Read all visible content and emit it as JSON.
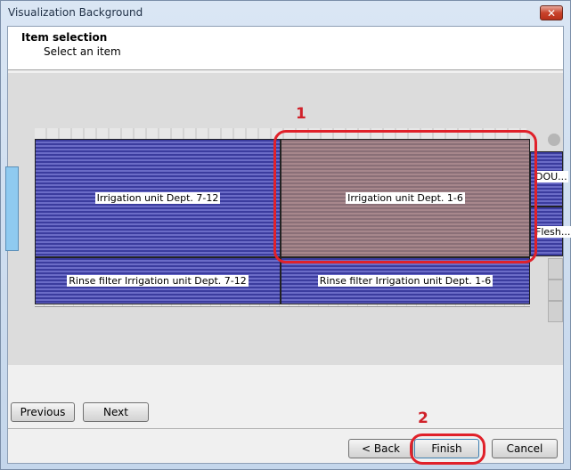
{
  "window": {
    "title": "Visualization Background",
    "close_symbol": "✕"
  },
  "header": {
    "title": "Item selection",
    "subtitle": "Select an item"
  },
  "visualization": {
    "cells": [
      {
        "label": "Irrigation unit Dept. 7-12",
        "color": "#5556b4"
      },
      {
        "label": "Irrigation unit Dept. 1-6",
        "color": "#9a7c82"
      },
      {
        "label": "Rinse filter Irrigation unit Dept. 7-12",
        "color": "#5556b4"
      },
      {
        "label": "Rinse filter Irrigation unit Dept. 1-6",
        "color": "#5556b4"
      }
    ],
    "side_items": [
      {
        "label": "DOU..."
      },
      {
        "label": "Flesh..."
      }
    ]
  },
  "annotations": [
    {
      "number": "1",
      "target": "Irrigation unit Dept. 1-6"
    },
    {
      "number": "2",
      "target": "Finish"
    }
  ],
  "buttons": {
    "previous": "Previous",
    "next": "Next",
    "back": "< Back",
    "finish": "Finish",
    "cancel": "Cancel"
  },
  "colors": {
    "annotation": "#e0212a",
    "cell_blue": "#5556b4",
    "cell_selected": "#9a7c82"
  }
}
